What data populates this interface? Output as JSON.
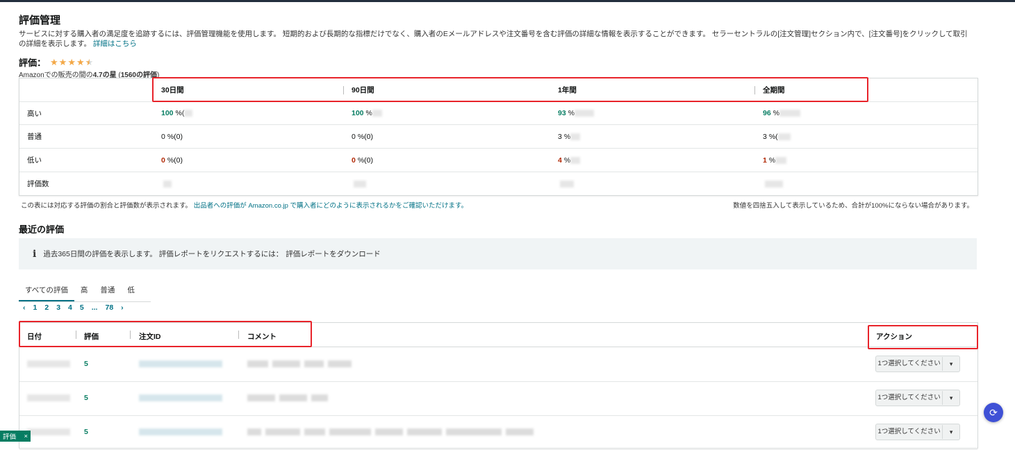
{
  "page": {
    "title": "評価管理",
    "description": "サービスに対する購入者の満足度を追跡するには、評価管理機能を使用します。 短期的および長期的な指標だけでなく、購入者のEメールアドレスや注文番号を含む評価の詳細な情報を表示することができます。 セラーセントラルの[注文管理]セクション内で、[注文番号]をクリックして取引の詳細を表示します。",
    "details_link": "詳細はこちら"
  },
  "rating": {
    "label": "評価：",
    "stars_value": 4.7,
    "summary_prefix": "Amazonでの販売の間の",
    "summary_value": "4.7の星",
    "summary_count": "1560の評価"
  },
  "perf_table": {
    "columns": [
      "30日間",
      "90日間",
      "1年間",
      "全期間"
    ],
    "rows": [
      {
        "label": "高い",
        "tone": "green",
        "values": [
          {
            "num": "100",
            "rest": "%(",
            "blur": true
          },
          {
            "num": "100",
            "rest": "%",
            "blur": true
          },
          {
            "num": "93",
            "rest": "%",
            "blur": true
          },
          {
            "num": "96",
            "rest": "%",
            "blur": true
          }
        ]
      },
      {
        "label": "普通",
        "tone": "plain",
        "values": [
          {
            "num": "0",
            "rest": "%(0)",
            "blur": false
          },
          {
            "num": "0",
            "rest": "%(0)",
            "blur": false
          },
          {
            "num": "3",
            "rest": "%",
            "blur": true
          },
          {
            "num": "3",
            "rest": "%(",
            "blur": true
          }
        ]
      },
      {
        "label": "低い",
        "tone": "red",
        "values": [
          {
            "num": "0",
            "rest": "%(0)",
            "blur": false
          },
          {
            "num": "0",
            "rest": "%(0)",
            "blur": false
          },
          {
            "num": "4",
            "rest": "%",
            "blur": true
          },
          {
            "num": "1",
            "rest": "%",
            "blur": true
          }
        ]
      },
      {
        "label": "評価数",
        "tone": "plain",
        "values": [
          {
            "num": "",
            "rest": "",
            "blur": true
          },
          {
            "num": "",
            "rest": "",
            "blur": true
          },
          {
            "num": "",
            "rest": "",
            "blur": true
          },
          {
            "num": "",
            "rest": "",
            "blur": true
          }
        ]
      }
    ],
    "note_left_prefix": "この表には対応する評価の割合と評価数が表示されます。",
    "note_left_link": "出品者への評価が Amazon.co.jp で購入者にどのように表示されるかをご確認いただけます。",
    "note_right": "数値を四捨五入して表示しているため、合計が100%にならない場合があります。"
  },
  "recent": {
    "title": "最近の評価",
    "info_text": "過去365日間の評価を表示します。 評価レポートをリクエストするには：",
    "info_link": "評価レポートをダウンロード",
    "tabs": [
      "すべての評価",
      "高",
      "普通",
      "低"
    ],
    "pager": [
      "‹",
      "1",
      "2",
      "3",
      "4",
      "5",
      "...",
      "78",
      "›"
    ],
    "headers": {
      "date": "日付",
      "rating": "評価",
      "order_id": "注文ID",
      "comment": "コメント",
      "action": "アクション"
    },
    "rows": [
      {
        "rating": "5",
        "action_label": "1つ選択してください"
      },
      {
        "rating": "5",
        "action_label": "1つ選択してください"
      },
      {
        "rating": "5",
        "action_label": "1つ選択してください"
      }
    ]
  },
  "bottom_tab": {
    "label": "評価",
    "close": "×"
  },
  "colors": {
    "link": "#007185",
    "green": "#067d62",
    "red": "#b12704",
    "star": "#f3a847",
    "highlight": "#e8232a"
  }
}
